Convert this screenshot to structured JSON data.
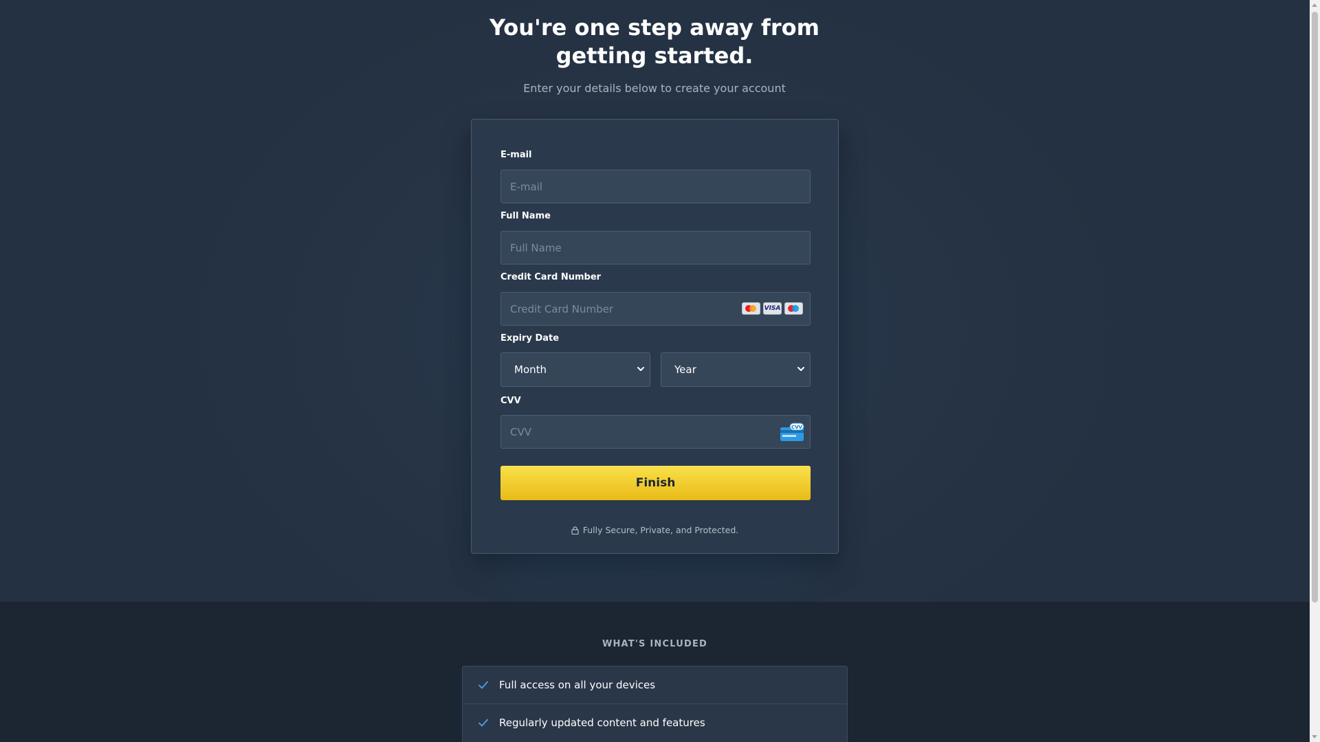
{
  "header": {
    "title_line1": "You're one step away from",
    "title_line2": "getting started.",
    "subtitle": "Enter your details below to create your account"
  },
  "form": {
    "email": {
      "label": "E-mail",
      "placeholder": "E-mail",
      "value": ""
    },
    "full_name": {
      "label": "Full Name",
      "placeholder": "Full Name",
      "value": ""
    },
    "card_number": {
      "label": "Credit Card Number",
      "placeholder": "Credit Card Number",
      "value": "",
      "brand_icons": [
        "mastercard-icon",
        "visa-icon",
        "maestro-icon"
      ],
      "visa_text": "VISA"
    },
    "expiry": {
      "label": "Expiry Date",
      "month_value": "Month",
      "year_value": "Year"
    },
    "cvv": {
      "label": "CVV",
      "placeholder": "CVV",
      "value": "",
      "icon": "cvv-card-icon",
      "icon_text": "CVV"
    },
    "submit_label": "Finish",
    "secure_text": "Fully Secure, Private, and Protected."
  },
  "included": {
    "title": "WHAT'S INCLUDED",
    "items": [
      {
        "text": "Full access on all your devices"
      },
      {
        "text": "Regularly updated content and features"
      }
    ]
  },
  "colors": {
    "page_bg": "#253243",
    "card_bg": "#2b394c",
    "input_bg": "#364659",
    "accent_yellow": "#f4d22e",
    "check_blue": "#4aa3e8",
    "included_bg": "#1c2532"
  }
}
